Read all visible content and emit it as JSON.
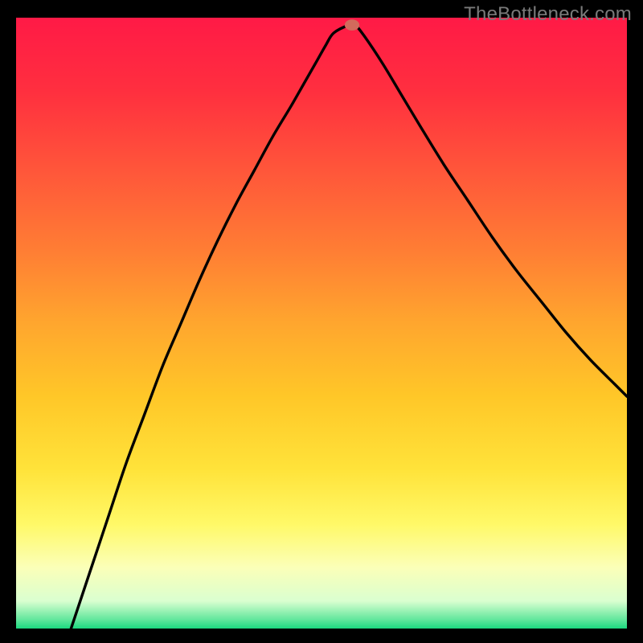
{
  "watermark": "TheBottleneck.com",
  "chart_data": {
    "type": "line",
    "title": "",
    "xlabel": "",
    "ylabel": "",
    "xlim": [
      0,
      100
    ],
    "ylim": [
      100,
      0
    ],
    "background_gradient": {
      "stops": [
        {
          "offset": 0.0,
          "color": "#ff1a46"
        },
        {
          "offset": 0.12,
          "color": "#ff2f3f"
        },
        {
          "offset": 0.25,
          "color": "#ff563a"
        },
        {
          "offset": 0.38,
          "color": "#ff7d34"
        },
        {
          "offset": 0.5,
          "color": "#ffa62e"
        },
        {
          "offset": 0.62,
          "color": "#ffc728"
        },
        {
          "offset": 0.74,
          "color": "#ffe33a"
        },
        {
          "offset": 0.83,
          "color": "#fff968"
        },
        {
          "offset": 0.9,
          "color": "#fbffb8"
        },
        {
          "offset": 0.955,
          "color": "#daffd0"
        },
        {
          "offset": 0.985,
          "color": "#63e79d"
        },
        {
          "offset": 1.0,
          "color": "#1bd87f"
        }
      ]
    },
    "series": [
      {
        "name": "bottleneck-curve",
        "color": "#000000",
        "width": 3.4,
        "x": [
          9.0,
          12,
          15,
          18,
          21,
          24,
          27,
          30,
          33,
          36,
          39,
          42,
          45,
          47,
          49,
          50.7,
          52,
          54.5,
          55.5,
          57,
          60,
          63,
          66,
          70,
          74,
          78,
          82,
          86,
          90,
          94,
          98,
          100
        ],
        "values": [
          0,
          9,
          18,
          27,
          35,
          43,
          50,
          57,
          63.5,
          69.5,
          75,
          80.5,
          85.5,
          89,
          92.5,
          95.5,
          97.5,
          98.8,
          98.8,
          97,
          92.5,
          87.5,
          82.5,
          76,
          70,
          64,
          58.5,
          53.5,
          48.5,
          44,
          40,
          38
        ]
      }
    ],
    "markers": [
      {
        "name": "optimal-point",
        "x": 55.0,
        "y": 98.8,
        "rx": 1.2,
        "ry": 0.9,
        "color": "#d26a5c"
      }
    ]
  }
}
